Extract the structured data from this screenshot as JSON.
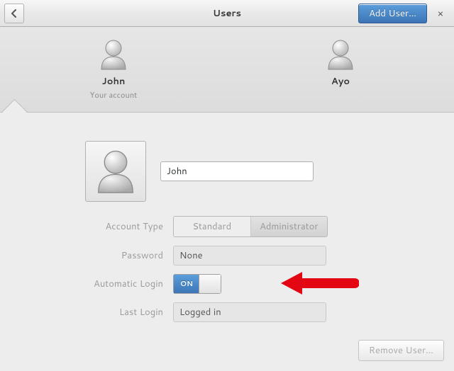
{
  "header": {
    "title": "Users",
    "add_user_label": "Add User…",
    "close_glyph": "×",
    "back_glyph": "‹"
  },
  "chooser": {
    "users": [
      {
        "name": "John",
        "sub": "Your account",
        "selected": true
      },
      {
        "name": "Ayo",
        "sub": "",
        "selected": false
      }
    ]
  },
  "details": {
    "name_value": "John",
    "labels": {
      "account_type": "Account Type",
      "password": "Password",
      "automatic_login": "Automatic Login",
      "last_login": "Last Login"
    },
    "account_type": {
      "options": [
        "Standard",
        "Administrator"
      ],
      "selected": "Administrator"
    },
    "password_display": "None",
    "automatic_login": {
      "state": "ON"
    },
    "last_login_display": "Logged in"
  },
  "footer": {
    "remove_user_label": "Remove User…"
  },
  "colors": {
    "accent": "#3d75b6",
    "arrow": "#e30613"
  }
}
